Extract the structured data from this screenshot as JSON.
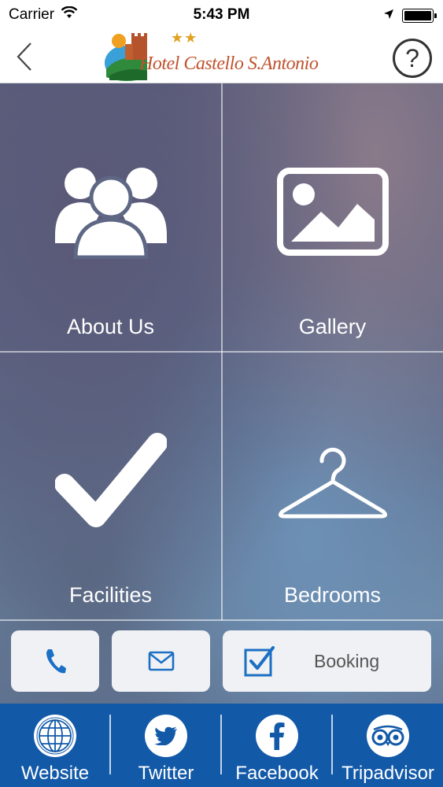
{
  "status_bar": {
    "carrier": "Carrier",
    "time": "5:43 PM"
  },
  "nav": {
    "logo_text": "Hotel Castello S.Antonio",
    "logo_stars": "★★",
    "help_label": "?"
  },
  "tiles": [
    {
      "label": "About Us",
      "icon": "group-icon"
    },
    {
      "label": "Gallery",
      "icon": "picture-icon"
    },
    {
      "label": "Facilities",
      "icon": "checkmark-icon"
    },
    {
      "label": "Bedrooms",
      "icon": "hanger-icon"
    }
  ],
  "actions": {
    "phone_icon": "phone-icon",
    "mail_icon": "mail-icon",
    "booking_label": "Booking"
  },
  "social": [
    {
      "label": "Website",
      "icon": "globe-icon"
    },
    {
      "label": "Twitter",
      "icon": "twitter-icon"
    },
    {
      "label": "Facebook",
      "icon": "facebook-icon"
    },
    {
      "label": "Tripadvisor",
      "icon": "tripadvisor-icon"
    }
  ],
  "colors": {
    "accent": "#1b6fc4",
    "bottom_bar": "#1259a8",
    "logo_text": "#c0522d"
  }
}
